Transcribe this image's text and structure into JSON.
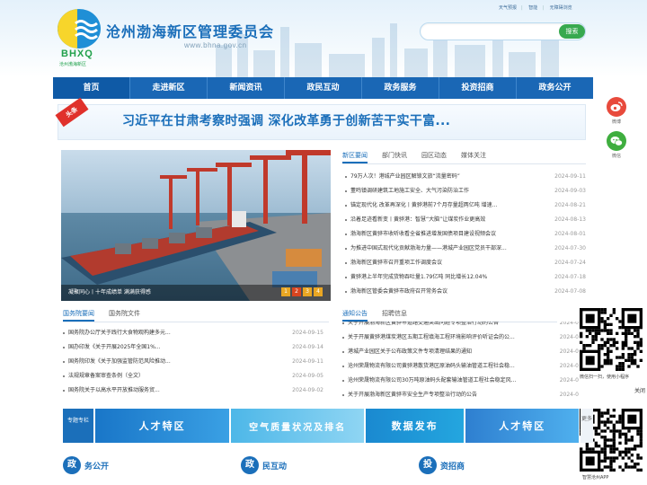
{
  "header": {
    "site_title": "沧州渤海新区管理委员会",
    "site_url": "www.bhna.gov.cn",
    "logo_letters": "BHXQ",
    "logo_sub": "沧州渤海新区",
    "top_links": [
      "天气预报",
      "智能",
      "无障碍浏览"
    ],
    "search_button": "搜索"
  },
  "nav": [
    "首页",
    "走进新区",
    "新闻资讯",
    "政民互动",
    "政务服务",
    "投资招商",
    "政务公开"
  ],
  "headline": {
    "badge": "头条",
    "text": "习近平在甘肃考察时强调 深化改革勇于创新苦干实干富..."
  },
  "side_icons": [
    {
      "name": "weibo-icon",
      "label": "微博"
    },
    {
      "name": "wechat-icon",
      "label": "微信"
    }
  ],
  "photo": {
    "caption": "凝聚同心丨十年成绩单 满满获得感",
    "pages": [
      "1",
      "2",
      "3",
      "4"
    ],
    "active_page": 2
  },
  "news_panel": {
    "tabs": [
      "新区要闻",
      "部门快讯",
      "园区动态",
      "媒体关注"
    ],
    "active_tab": 0,
    "items": [
      {
        "title": "79万人次！港城产业园区解锁文旅“流量密码”",
        "date": "2024-09-11"
      },
      {
        "title": "董鸣镇调研建筑工地施工安全、大气污染防治工作",
        "date": "2024-09-03"
      },
      {
        "title": "锚定现代化 改革再深化丨黄骅港前7个月存量超两亿吨 增速...",
        "date": "2024-08-21"
      },
      {
        "title": "沿着足迹看新变丨黄骅港：智慧“大脑”让煤炭作业更高效",
        "date": "2024-08-13"
      },
      {
        "title": "渤海新区黄骅市收听收看全省推进增发国债项目建设视频会议",
        "date": "2024-08-01"
      },
      {
        "title": "为推进中国式现代化贡献渤海力量——港城产业园区党员干部深...",
        "date": "2024-07-30"
      },
      {
        "title": "渤海新区黄骅市召开重项工作调度会议",
        "date": "2024-07-24"
      },
      {
        "title": "黄骅港上半年完成货物吞吐量1.79亿吨 同比增长12.04%",
        "date": "2024-07-18"
      },
      {
        "title": "渤海新区管委会黄骅市政府召开常务会议",
        "date": "2024-07-08"
      }
    ]
  },
  "state_council": {
    "tabs": [
      "国务院要闻",
      "国务院文件"
    ],
    "active_tab": 0,
    "items": [
      {
        "title": "国务院办公厅关于践行大食物观构建多元...",
        "date": "2024-09-15"
      },
      {
        "title": "国办印发《关于开展2025年全国1%...",
        "date": "2024-09-14"
      },
      {
        "title": "国务院印发《关于加强监管防范风险推动...",
        "date": "2024-09-11"
      },
      {
        "title": "法规规章备案审查条例（全文）",
        "date": "2024-09-05"
      },
      {
        "title": "国务院关于以高水平开放推动服务贸...",
        "date": "2024-09-02"
      }
    ]
  },
  "notices": {
    "tabs": [
      "通知公告",
      "招聘信息"
    ],
    "active_tab": 0,
    "items": [
      {
        "title": "关于开展渤海新区黄骅市道路交通突出问题专项整治行动的公告",
        "date": "2024-0"
      },
      {
        "title": "关于开展黄骅港煤炭港区五期工程填海工程环境影响评价听证会的公...",
        "date": "2024-0"
      },
      {
        "title": "港城产业园区关于公布政策文件专项清理结果的通知",
        "date": "2024-0"
      },
      {
        "title": "沧州荣晟物流有限公司黄骅港散货港区原油码头输油管道工程社会稳...",
        "date": "2024-0"
      },
      {
        "title": "沧州荣晟物流有限公司30万吨原油码头配套输油管道工程社会稳定风...",
        "date": "2024-0"
      },
      {
        "title": "关于开展渤海新区黄骅市安全生产专项整治行动的公告",
        "date": "2024-0"
      }
    ]
  },
  "banners": {
    "zt_label": "专题专栏",
    "items": [
      "人才特区",
      "空气质量状况及排名",
      "数据发布",
      "人才特区"
    ],
    "more": "更多"
  },
  "sections": [
    {
      "icon": "政",
      "label": "务公开"
    },
    {
      "icon": "政",
      "label": "民互动"
    },
    {
      "icon": "投",
      "label": "资招商"
    }
  ],
  "qr": {
    "caption1": "微信扫一扫，使用小程序",
    "close": "关闭",
    "caption2": "智慧沧州APP"
  },
  "colors": {
    "primary": "#1a67b5",
    "accent": "#e0312b",
    "green": "#37a94f"
  }
}
